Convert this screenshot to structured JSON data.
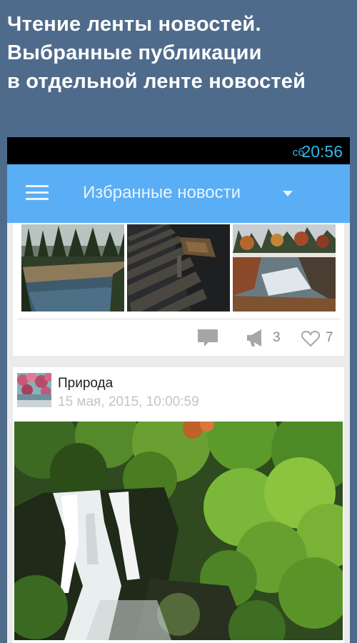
{
  "promo": {
    "line1": "Чтение ленты новостей.",
    "line2": "Выбранные публикации",
    "line3": "в отдельной ленте новостей"
  },
  "status_bar": {
    "day": "сб",
    "time": "20:56",
    "color": "#33b5e5"
  },
  "app_bar": {
    "title": "Избранные новости",
    "color": "#5aaef5"
  },
  "card1": {
    "images": [
      {
        "icon": "forest-lake-photo"
      },
      {
        "icon": "pier-boat-photo"
      },
      {
        "icon": "autumn-lake-photo"
      }
    ],
    "actions": {
      "reposts": "3",
      "likes": "7"
    }
  },
  "card2": {
    "source": "Природа",
    "date": "15 мая, 2015, 10:00:59",
    "image": {
      "icon": "waterfall-photo"
    }
  }
}
